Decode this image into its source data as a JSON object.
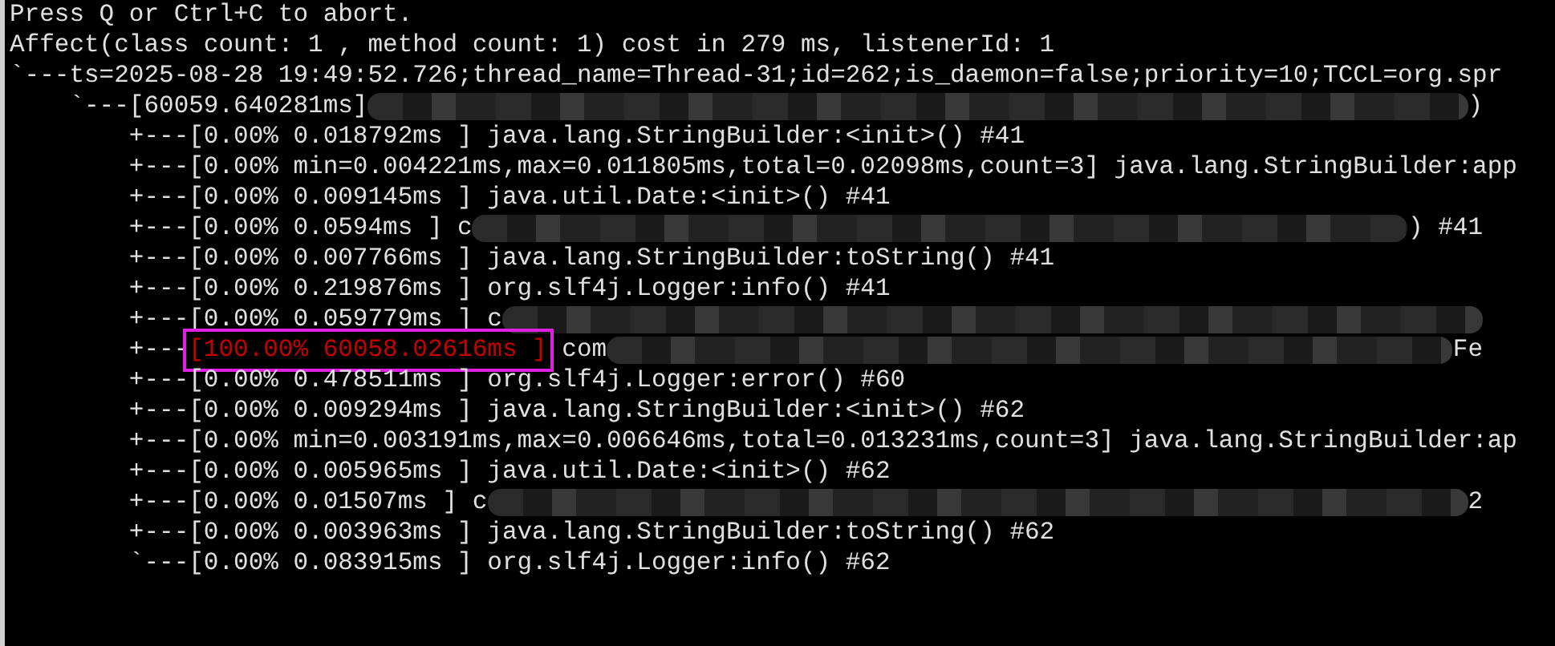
{
  "terminal": {
    "lines": [
      {
        "segments": [
          {
            "kind": "text",
            "text": "Press Q or Ctrl+C to abort."
          }
        ]
      },
      {
        "segments": [
          {
            "kind": "text",
            "text": "Affect(class count: 1 , method count: 1) cost in 279 ms, listenerId: 1"
          }
        ]
      },
      {
        "segments": [
          {
            "kind": "text",
            "text": "`---ts=2025-08-28 19:49:52.726;thread_name=Thread-31;id=262;is_daemon=false;priority=10;TCCL=org.spr"
          }
        ]
      },
      {
        "segments": [
          {
            "kind": "text",
            "text": "    `---[60059.640281ms]"
          },
          {
            "kind": "blur"
          },
          {
            "kind": "text",
            "text": ")"
          }
        ]
      },
      {
        "segments": [
          {
            "kind": "text",
            "text": "        +---[0.00% 0.018792ms ] java.lang.StringBuilder:<init>() #41"
          }
        ]
      },
      {
        "segments": [
          {
            "kind": "text",
            "text": "        +---[0.00% min=0.004221ms,max=0.011805ms,total=0.02098ms,count=3] java.lang.StringBuilder:app"
          }
        ]
      },
      {
        "segments": [
          {
            "kind": "text",
            "text": "        +---[0.00% 0.009145ms ] java.util.Date:<init>() #41"
          }
        ]
      },
      {
        "segments": [
          {
            "kind": "text",
            "text": "        +---[0.00% 0.0594ms ] c"
          },
          {
            "kind": "blur"
          },
          {
            "kind": "text",
            "text": ") #41"
          }
        ]
      },
      {
        "segments": [
          {
            "kind": "text",
            "text": "        +---[0.00% 0.007766ms ] java.lang.StringBuilder:toString() #41"
          }
        ]
      },
      {
        "segments": [
          {
            "kind": "text",
            "text": "        +---[0.00% 0.219876ms ] org.slf4j.Logger:info() #41"
          }
        ]
      },
      {
        "segments": [
          {
            "kind": "text",
            "text": "        +---[0.00% 0.059779ms ] c"
          },
          {
            "kind": "blur"
          }
        ]
      },
      {
        "segments": [
          {
            "kind": "text",
            "text": "        +---"
          },
          {
            "kind": "alert",
            "text": "[100.00% 60058.02616ms ]"
          },
          {
            "kind": "text",
            "text": " com"
          },
          {
            "kind": "blur"
          },
          {
            "kind": "text",
            "text": "Fe"
          }
        ]
      },
      {
        "segments": [
          {
            "kind": "text",
            "text": "        +---[0.00% 0.478511ms ] org.slf4j.Logger:error() #60"
          }
        ]
      },
      {
        "segments": [
          {
            "kind": "text",
            "text": "        +---[0.00% 0.009294ms ] java.lang.StringBuilder:<init>() #62"
          }
        ]
      },
      {
        "segments": [
          {
            "kind": "text",
            "text": "        +---[0.00% min=0.003191ms,max=0.006646ms,total=0.013231ms,count=3] java.lang.StringBuilder:ap"
          }
        ]
      },
      {
        "segments": [
          {
            "kind": "text",
            "text": "        +---[0.00% 0.005965ms ] java.util.Date:<init>() #62"
          }
        ]
      },
      {
        "segments": [
          {
            "kind": "text",
            "text": "        +---[0.00% 0.01507ms ] c"
          },
          {
            "kind": "blur"
          },
          {
            "kind": "text",
            "text": "2"
          }
        ]
      },
      {
        "segments": [
          {
            "kind": "text",
            "text": "        +---[0.00% 0.003963ms ] java.lang.StringBuilder:toString() #62"
          }
        ]
      },
      {
        "segments": [
          {
            "kind": "text",
            "text": "        `---[0.00% 0.083915ms ] org.slf4j.Logger:info() #62"
          }
        ]
      }
    ]
  }
}
